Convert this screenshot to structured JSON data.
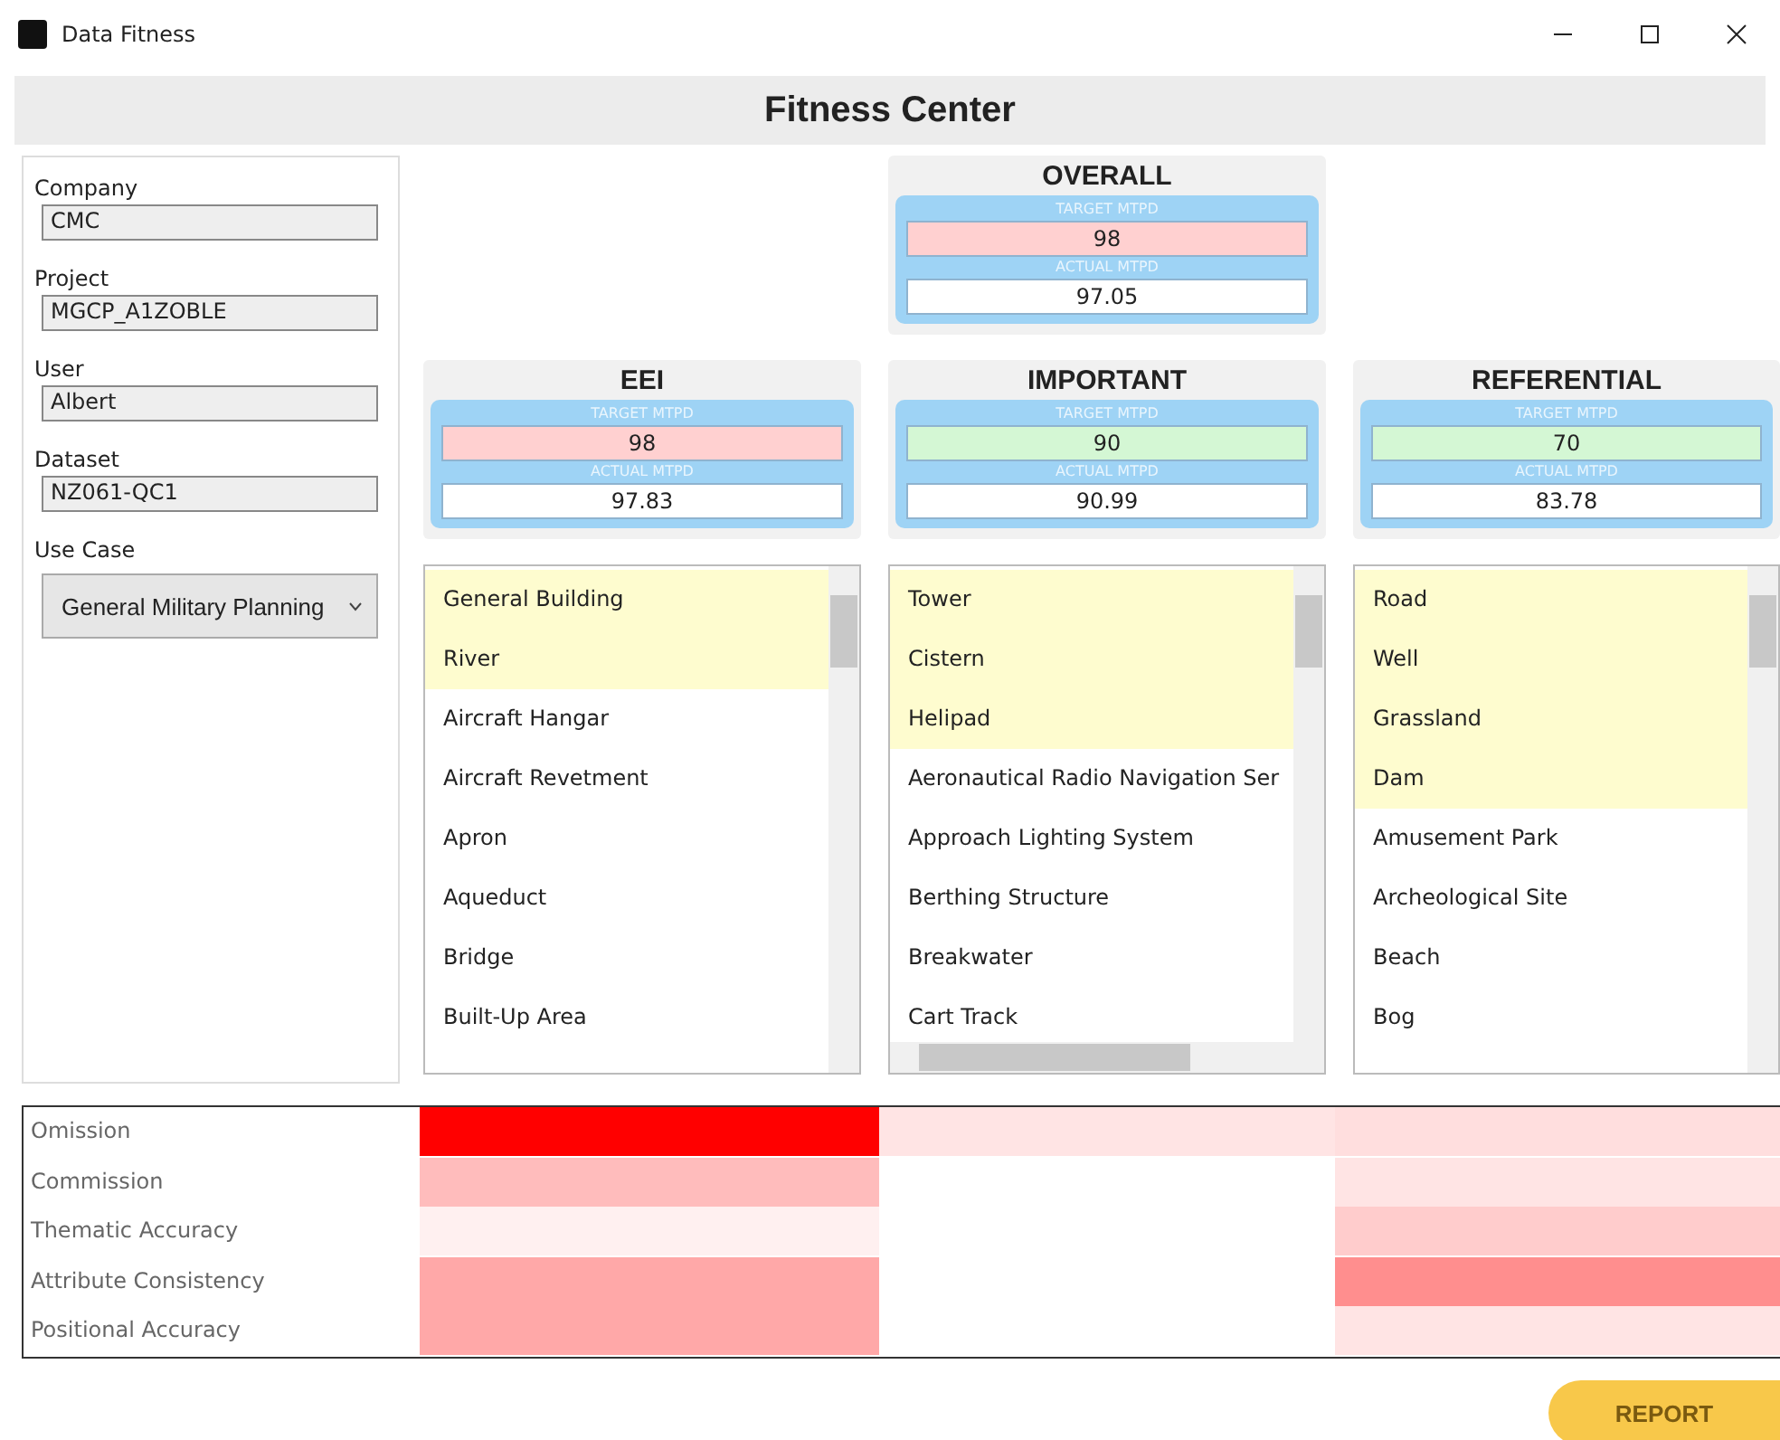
{
  "window": {
    "title": "Data Fitness"
  },
  "header": {
    "title": "Fitness Center"
  },
  "info_panel": {
    "fields": [
      {
        "label": "Company",
        "value": "CMC"
      },
      {
        "label": "Project",
        "value": "MGCP_A1ZOBLE"
      },
      {
        "label": "User",
        "value": "Albert"
      },
      {
        "label": "Dataset",
        "value": "NZ061-QC1"
      }
    ],
    "use_case": {
      "label": "Use Case",
      "value": "General Military Planning"
    }
  },
  "overall": {
    "title": "OVERALL",
    "target_label": "TARGET MTPD",
    "target": {
      "value": "98",
      "color": "#ffd0d0"
    },
    "actual_label": "ACTUAL MTPD",
    "actual": "97.05"
  },
  "categories": [
    {
      "title": "EEI",
      "target_label": "TARGET MTPD",
      "target": {
        "value": "98",
        "color": "#ffd0d0"
      },
      "actual_label": "ACTUAL MTPD",
      "actual": "97.83",
      "horizontal_scroll": false,
      "items": [
        {
          "label": "General Building",
          "highlighted": true
        },
        {
          "label": "River",
          "highlighted": true
        },
        {
          "label": "Aircraft Hangar",
          "highlighted": false
        },
        {
          "label": "Aircraft Revetment",
          "highlighted": false
        },
        {
          "label": "Apron",
          "highlighted": false
        },
        {
          "label": "Aqueduct",
          "highlighted": false
        },
        {
          "label": "Bridge",
          "highlighted": false
        },
        {
          "label": "Built-Up Area",
          "highlighted": false
        }
      ]
    },
    {
      "title": "IMPORTANT",
      "target_label": "TARGET MTPD",
      "target": {
        "value": "90",
        "color": "#d4f7d4"
      },
      "actual_label": "ACTUAL MTPD",
      "actual": "90.99",
      "horizontal_scroll": true,
      "items": [
        {
          "label": "Tower",
          "highlighted": true
        },
        {
          "label": "Cistern",
          "highlighted": true
        },
        {
          "label": "Helipad",
          "highlighted": true
        },
        {
          "label": "Aeronautical Radio Navigation Ser",
          "highlighted": false
        },
        {
          "label": "Approach Lighting System",
          "highlighted": false
        },
        {
          "label": "Berthing Structure",
          "highlighted": false
        },
        {
          "label": "Breakwater",
          "highlighted": false
        },
        {
          "label": "Cart Track",
          "highlighted": false
        }
      ]
    },
    {
      "title": "REFERENTIAL",
      "target_label": "TARGET MTPD",
      "target": {
        "value": "70",
        "color": "#d4f7d4"
      },
      "actual_label": "ACTUAL MTPD",
      "actual": "83.78",
      "horizontal_scroll": false,
      "items": [
        {
          "label": "Road",
          "highlighted": true
        },
        {
          "label": "Well",
          "highlighted": true
        },
        {
          "label": "Grassland",
          "highlighted": true
        },
        {
          "label": "Dam",
          "highlighted": true
        },
        {
          "label": "Amusement Park",
          "highlighted": false
        },
        {
          "label": "Archeological Site",
          "highlighted": false
        },
        {
          "label": "Beach",
          "highlighted": false
        },
        {
          "label": "Bog",
          "highlighted": false
        }
      ]
    }
  ],
  "heatmap": {
    "rows": [
      {
        "label": "Omission",
        "cells": [
          {
            "color": "#ff0000"
          },
          {
            "color": "#ffe4e4"
          },
          {
            "color": "#ffdede"
          }
        ]
      },
      {
        "label": "Commission",
        "cells": [
          {
            "color": "#ffbcbc"
          },
          {
            "color": "#ffffff"
          },
          {
            "color": "#ffe4e4"
          }
        ]
      },
      {
        "label": "Thematic Accuracy",
        "cells": [
          {
            "color": "#fff0f0"
          },
          {
            "color": "#ffffff"
          },
          {
            "color": "#ffcccc"
          }
        ]
      },
      {
        "label": "Attribute Consistency",
        "cells": [
          {
            "color": "#ffa8a8"
          },
          {
            "color": "#ffffff"
          },
          {
            "color": "#ff8e8e"
          }
        ]
      },
      {
        "label": "Positional Accuracy",
        "cells": [
          {
            "color": "#ffa8a8"
          },
          {
            "color": "#ffffff"
          },
          {
            "color": "#ffe4e4"
          }
        ]
      }
    ]
  },
  "report_button": "REPORT"
}
